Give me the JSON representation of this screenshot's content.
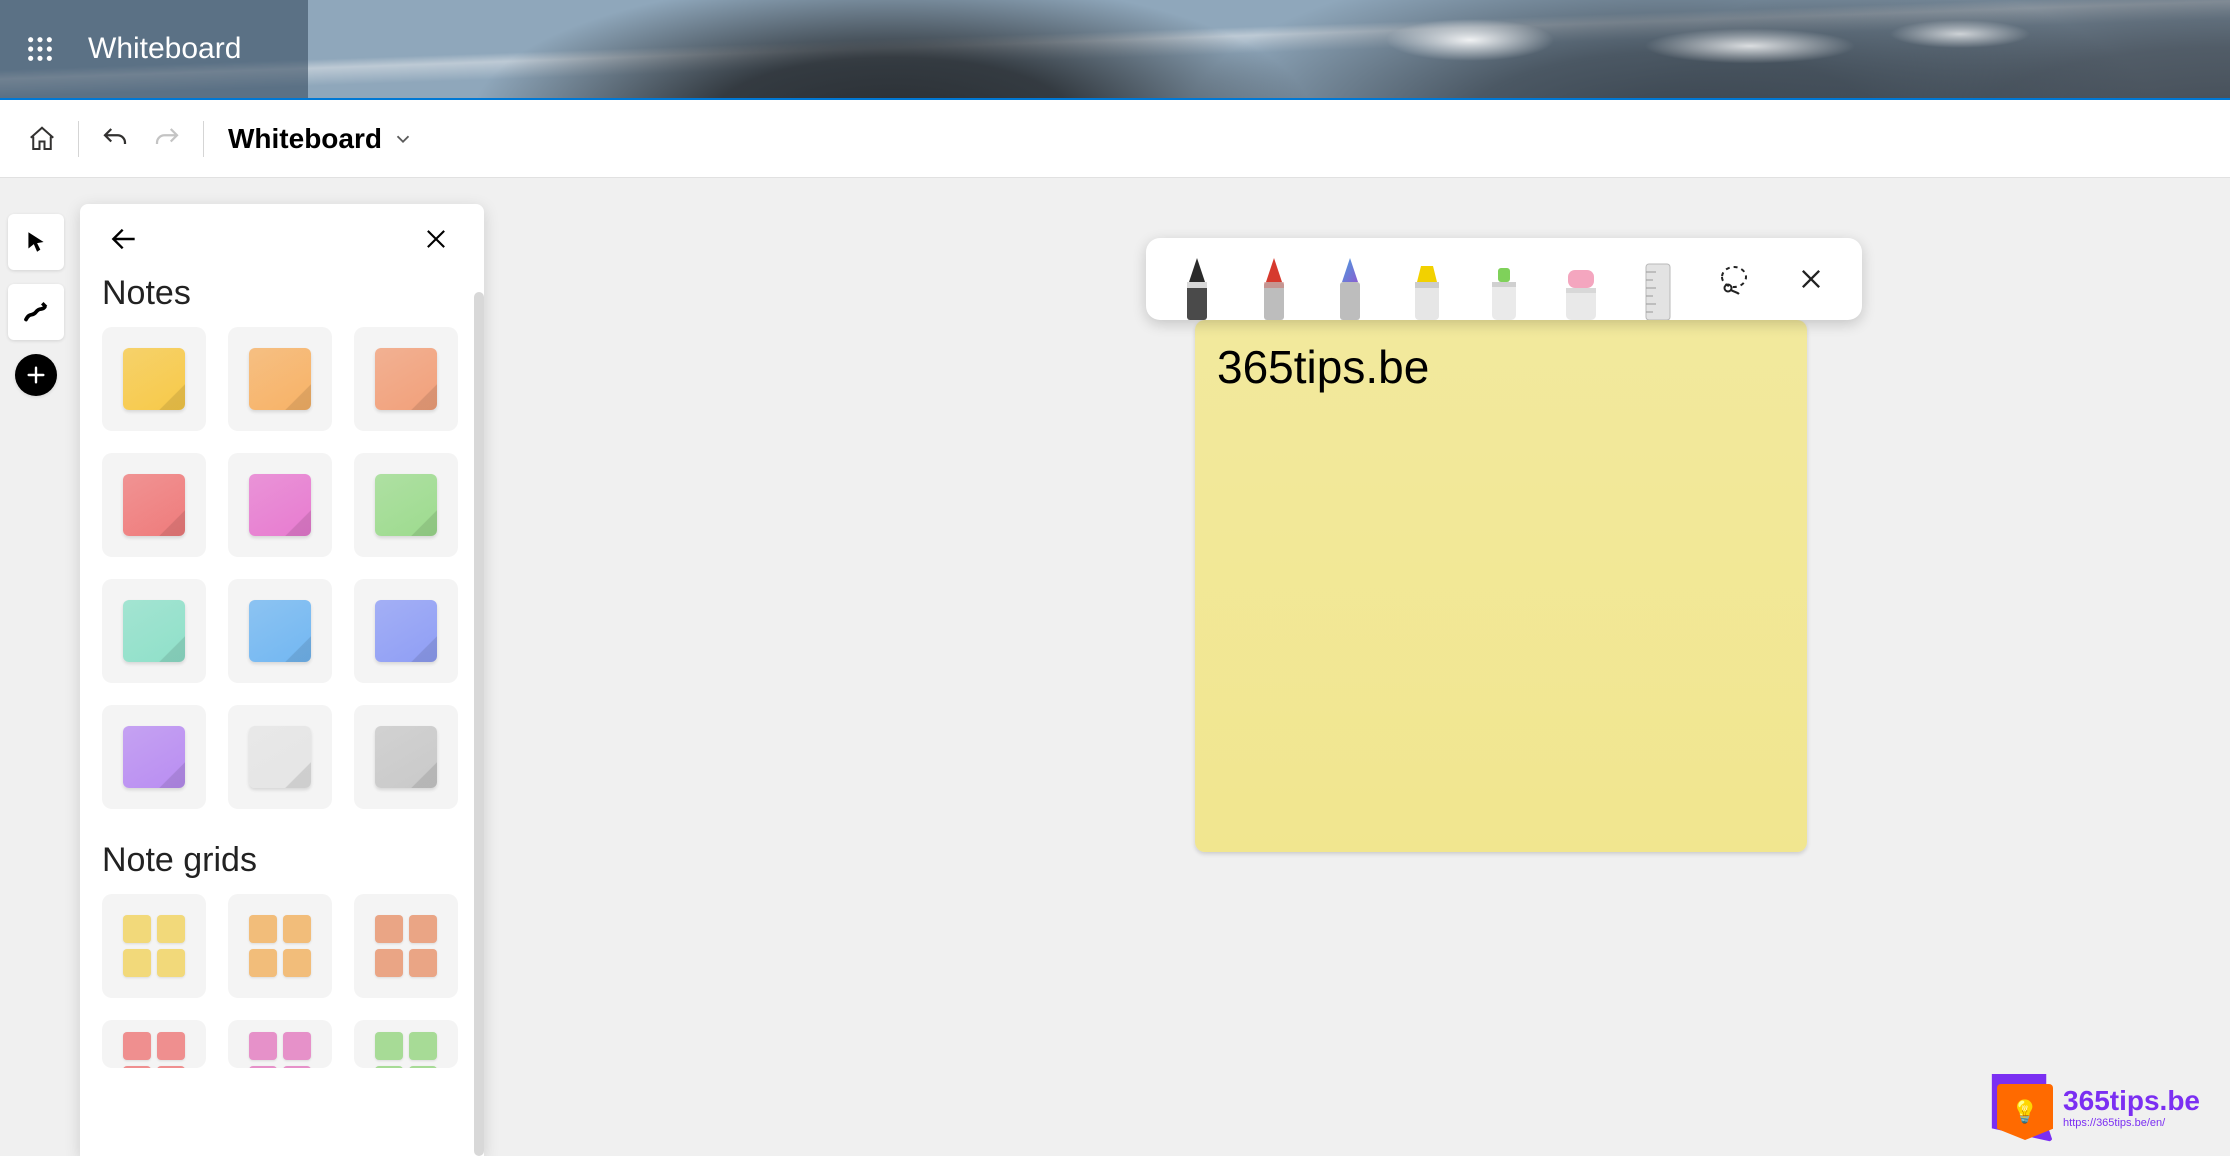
{
  "header": {
    "app_title": "Whiteboard"
  },
  "toolbar": {
    "board_name": "Whiteboard"
  },
  "panel": {
    "title_notes": "Notes",
    "title_note_grids": "Note grids",
    "note_colors": [
      "#f7c948",
      "#f7b266",
      "#f2a07a",
      "#ef7b7b",
      "#e77bd0",
      "#9ddb8e",
      "#8fe0c9",
      "#72b7f2",
      "#8f9ef5",
      "#b98df2",
      "#e5e5e5",
      "#c9c9c9"
    ],
    "grid_colors_row1": [
      "#f2d97a",
      "#f2bd7a",
      "#eaa585"
    ],
    "grid_colors_row2": [
      "#ef8f8f",
      "#e691c9",
      "#a7db96"
    ]
  },
  "sticky": {
    "text": "365tips.be"
  },
  "watermark": {
    "brand": "365tips.be",
    "url": "https://365tips.be/en/"
  }
}
